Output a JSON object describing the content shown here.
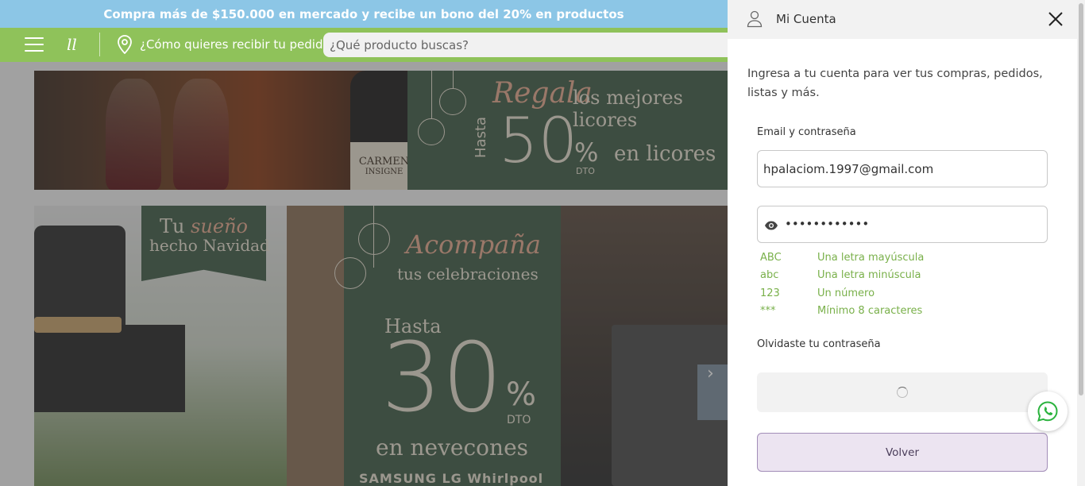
{
  "promo": {
    "text": "Compra más de $150.000 en mercado y recibe un bono del 20% en productos"
  },
  "nav": {
    "delivery_text": "¿Cómo quieres recibir tu pedido?",
    "search_placeholder": "¿Qué producto buscas?"
  },
  "banner1": {
    "brand_line1": "CARMEN",
    "brand_line2": "INSIGNE",
    "regala": "Regala",
    "mejores": "los mejores licores",
    "hasta": "Hasta",
    "number": "50",
    "percent": "%",
    "dto": "DTO",
    "category": "en licores"
  },
  "banner2": {
    "tu": "Tu ",
    "sueno": "sueño",
    "hecho": "hecho Navidad",
    "acompana": "Acompaña",
    "tus": "tus celebraciones",
    "hasta": "Hasta",
    "number": "30",
    "percent": "%",
    "dto": "DTO",
    "category": "en nevecones",
    "brands": "SAMSUNG  LG  Whirlpool",
    "arrow": "›"
  },
  "panel": {
    "title": "Mi Cuenta",
    "intro": "Ingresa a tu cuenta para ver tus compras, pedidos, listas y más.",
    "field_label": "Email y contraseña",
    "email_value": "hpalaciom.1997@gmail.com",
    "password_value": "••••••••••••",
    "rules": [
      {
        "code": "ABC",
        "text": "Una letra mayúscula"
      },
      {
        "code": "abc",
        "text": "Una letra minúscula"
      },
      {
        "code": "123",
        "text": "Un número"
      },
      {
        "code": "***",
        "text": "Mínimo 8 caracteres"
      }
    ],
    "forgot": "Olvidaste tu contraseña",
    "back_button": "Volver"
  },
  "colors": {
    "promo_bar": "#8cc6e6",
    "nav_bar": "#8fc25a",
    "rule_green": "#79b04a",
    "back_button_bg": "#ece4f1",
    "back_button_border": "#a28db8",
    "banner_green": "#3f5b46"
  },
  "icons": [
    "menu-icon",
    "brand-logo-icon",
    "location-pin-icon",
    "user-icon",
    "close-icon",
    "eye-icon",
    "loading-spinner-icon",
    "whatsapp-icon"
  ]
}
